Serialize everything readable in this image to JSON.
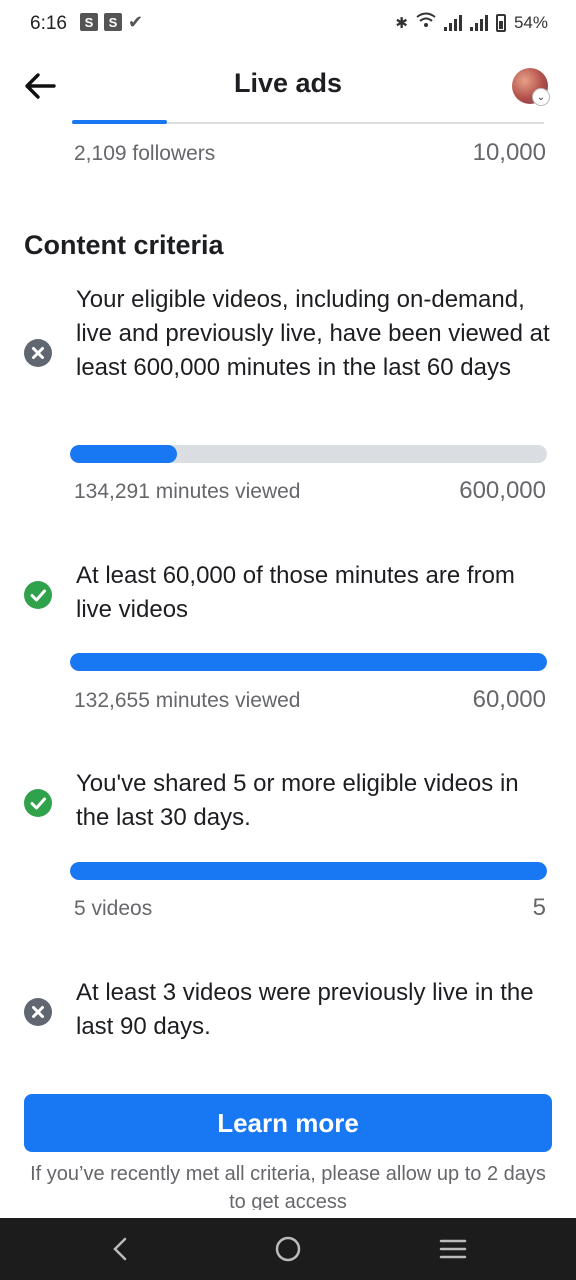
{
  "status_bar": {
    "time": "6:16",
    "left_icons": [
      "S",
      "S"
    ],
    "battery": "54%"
  },
  "header": {
    "title": "Live ads",
    "back_icon": "arrow-left-icon",
    "avatar_icon": "profile-avatar"
  },
  "followers": {
    "label": "2,109 followers",
    "target": "10,000"
  },
  "content_criteria": {
    "title": "Content criteria",
    "items": [
      {
        "status": "not-met",
        "text": "Your eligible videos, including on-demand, live and previously live, have been viewed at least 600,000 minutes in the last 60 days",
        "progress_label": "134,291 minutes viewed",
        "target": "600,000",
        "progress": 0.224
      },
      {
        "status": "met",
        "text": "At least 60,000 of those minutes are from live videos",
        "progress_label": "132,655 minutes viewed",
        "target": "60,000",
        "progress": 1.0
      },
      {
        "status": "met",
        "text": "You've shared 5 or more eligible videos in the last 30 days.",
        "progress_label": "5 videos",
        "target": "5",
        "progress": 1.0
      },
      {
        "status": "not-met",
        "text": "At least 3 videos were previously live in the last 90 days."
      }
    ]
  },
  "learn_more_label": "Learn more",
  "footnote": "If you’ve recently met all criteria, please allow up to 2 days to get access",
  "colors": {
    "accent": "#1877f2",
    "pass": "#31a24c",
    "fail": "#606770"
  }
}
